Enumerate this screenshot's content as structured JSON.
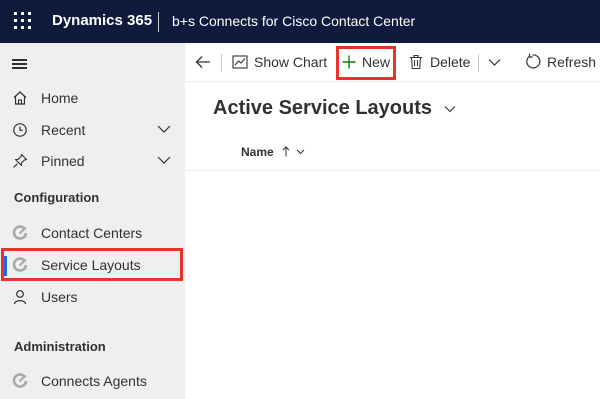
{
  "topbar": {
    "brand": "Dynamics 365",
    "app_name": "b+s Connects for Cisco Contact Center"
  },
  "sidebar": {
    "items": [
      {
        "label": "Home",
        "icon": "home-icon"
      },
      {
        "label": "Recent",
        "icon": "clock-icon"
      },
      {
        "label": "Pinned",
        "icon": "pin-icon"
      }
    ],
    "sections": [
      {
        "title": "Configuration",
        "items": [
          {
            "label": "Contact Centers",
            "icon": "entity-icon"
          },
          {
            "label": "Service Layouts",
            "icon": "entity-icon",
            "selected": true
          },
          {
            "label": "Users",
            "icon": "user-icon"
          }
        ]
      },
      {
        "title": "Administration",
        "items": [
          {
            "label": "Connects Agents",
            "icon": "entity-icon"
          }
        ]
      }
    ]
  },
  "commandbar": {
    "back_icon": "back-arrow-icon",
    "show_chart": "Show Chart",
    "new": "New",
    "delete": "Delete",
    "refresh": "Refresh"
  },
  "view": {
    "title": "Active Service Layouts",
    "columns": [
      {
        "label": "Name",
        "sort": "ascending"
      }
    ]
  },
  "colors": {
    "topbar": "#0f1b3d",
    "sidebar": "#efefef",
    "accent": "#2266e3",
    "highlight": "#e8322a",
    "new_plus": "#107c10"
  }
}
